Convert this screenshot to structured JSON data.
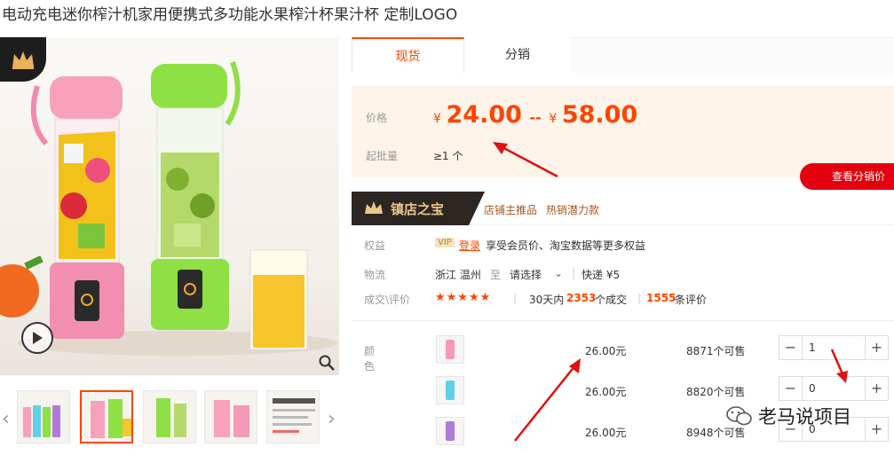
{
  "product": {
    "title": "电动充电迷你榨汁机家用便携式多功能水果榨汁杯果汁杯 定制LOGO"
  },
  "tabs": [
    {
      "label": "现货",
      "active": true
    },
    {
      "label": "分销",
      "active": false
    }
  ],
  "price_section": {
    "price_label": "价格",
    "currency": "¥",
    "price_low": "24.00",
    "range_sep": "--",
    "price_high": "58.00",
    "moq_label": "起批量",
    "moq_value": "≥1 个",
    "dist_button": "查看分销价"
  },
  "treasure": {
    "title": "镇店之宝",
    "tag1": "店铺主推品",
    "tag2": "热销潜力款"
  },
  "rights": {
    "label": "权益",
    "vip": "VIP",
    "login": "登录",
    "text": "享受会员价、淘宝数据等更多权益"
  },
  "logistics": {
    "label": "物流",
    "origin": "浙江 温州",
    "to": "至",
    "dest": "请选择",
    "method": "快递 ¥5"
  },
  "deals": {
    "label": "成交\\评价",
    "stars": "★★★★★",
    "period_prefix": "30天内",
    "count": "2353",
    "count_suffix": "个成交",
    "reviews": "1555",
    "reviews_suffix": "条评价"
  },
  "sku": {
    "label": "颜色",
    "rows": [
      {
        "color": "#f39ab8",
        "price": "26.00元",
        "stock": "8871个可售",
        "qty": "1"
      },
      {
        "color": "#5fd0e6",
        "price": "26.00元",
        "stock": "8820个可售",
        "qty": "0"
      },
      {
        "color": "#b07ad9",
        "price": "26.00元",
        "stock": "8948个可售",
        "qty": "0"
      }
    ]
  },
  "watermark": "老马说项目",
  "colors": {
    "accent": "#ff4400",
    "price_bg": "#fff4ea",
    "dist_red": "#e4000f"
  }
}
